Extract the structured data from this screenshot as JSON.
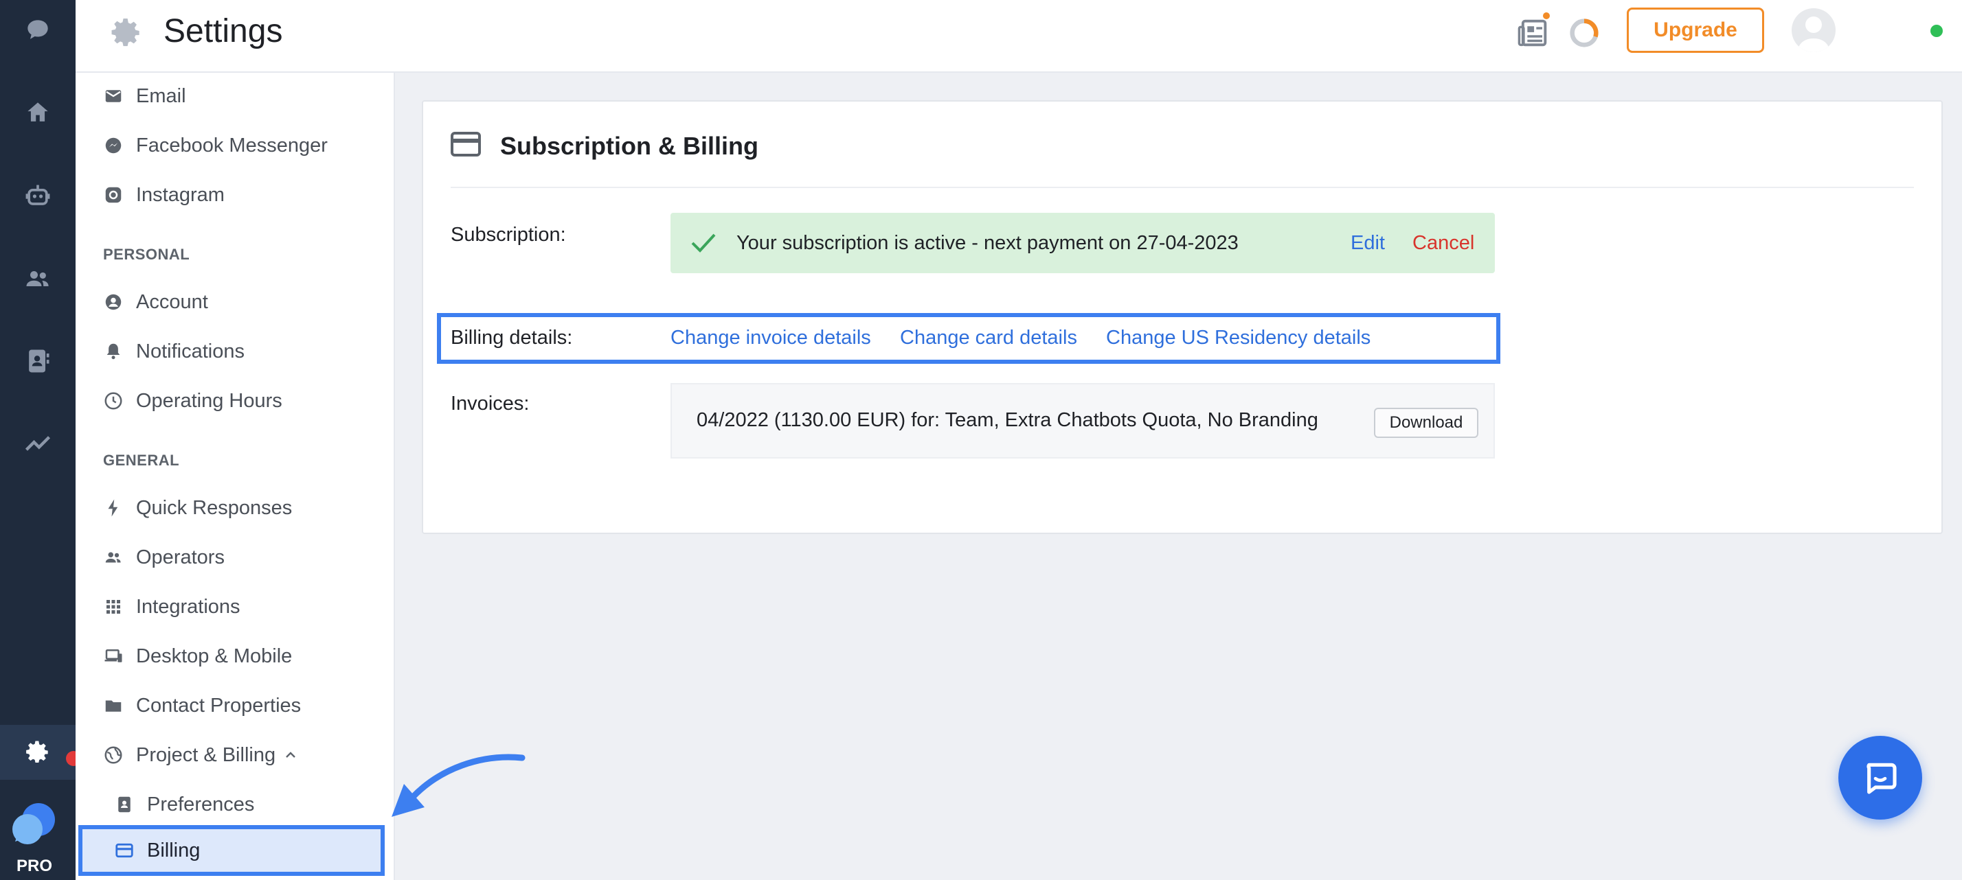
{
  "header": {
    "title": "Settings",
    "upgrade_label": "Upgrade"
  },
  "rail": {
    "badge": "PRO"
  },
  "sidebar": {
    "channels": [
      {
        "label": "Email",
        "icon": "mail-icon"
      },
      {
        "label": "Facebook Messenger",
        "icon": "messenger-icon"
      },
      {
        "label": "Instagram",
        "icon": "instagram-icon"
      }
    ],
    "personal_heading": "PERSONAL",
    "personal": [
      {
        "label": "Account",
        "icon": "account-icon"
      },
      {
        "label": "Notifications",
        "icon": "bell-icon"
      },
      {
        "label": "Operating Hours",
        "icon": "clock-icon"
      }
    ],
    "general_heading": "GENERAL",
    "general": [
      {
        "label": "Quick Responses",
        "icon": "lightning-icon"
      },
      {
        "label": "Operators",
        "icon": "operators-icon"
      },
      {
        "label": "Integrations",
        "icon": "grid-icon"
      },
      {
        "label": "Desktop & Mobile",
        "icon": "devices-icon"
      },
      {
        "label": "Contact Properties",
        "icon": "folder-icon"
      },
      {
        "label": "Project & Billing",
        "icon": "globe-icon"
      }
    ],
    "project_billing_sub": [
      {
        "label": "Preferences",
        "icon": "preferences-icon"
      },
      {
        "label": "Billing",
        "icon": "card-icon"
      }
    ]
  },
  "billing": {
    "title": "Subscription & Billing",
    "subscription_label": "Subscription:",
    "subscription_status": "Your subscription is active - next payment on 27-04-2023",
    "edit_label": "Edit",
    "cancel_label": "Cancel",
    "billing_details_label": "Billing details:",
    "links": [
      "Change invoice details",
      "Change card details",
      "Change US Residency details"
    ],
    "invoices_label": "Invoices:",
    "invoice_text": "04/2022 (1130.00 EUR) for: Team, Extra Chatbots Quota, No Branding",
    "download_label": "Download"
  },
  "colors": {
    "accent": "#3d7ff0",
    "upgrade": "#f28c28",
    "success_bg": "#d9f1dc",
    "link": "#2f6fdc",
    "danger": "#d8342c",
    "rail_bg": "#1f2b3d"
  }
}
